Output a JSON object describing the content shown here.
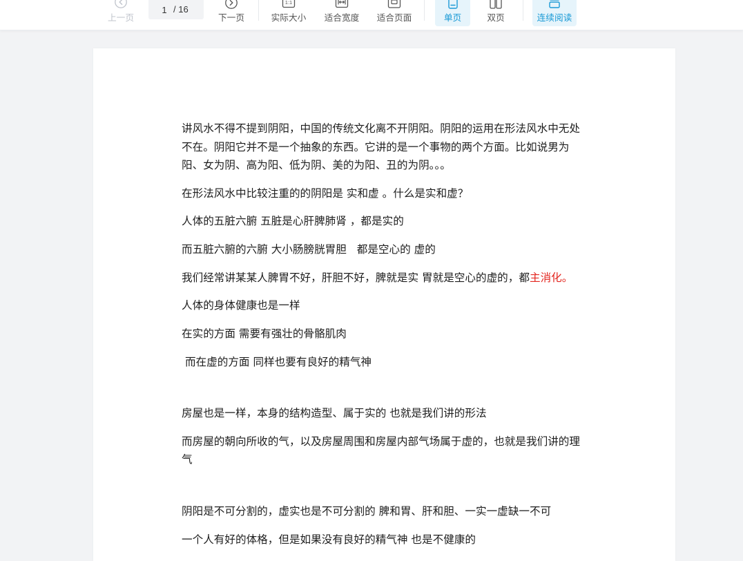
{
  "toolbar": {
    "prev_page": {
      "label": "上一页",
      "icon": "circle-arrow-left-icon",
      "disabled": true
    },
    "page_indicator": {
      "current": "1",
      "total": "/ 16"
    },
    "next_page": {
      "label": "下一页",
      "icon": "circle-arrow-right-icon"
    },
    "actual_size": {
      "label": "实际大小",
      "icon": "actual-size-icon",
      "icon_text": "1:1"
    },
    "fit_width": {
      "label": "适合宽度",
      "icon": "fit-width-icon"
    },
    "fit_page": {
      "label": "适合页面",
      "icon": "fit-page-icon"
    },
    "single_page": {
      "label": "单页",
      "icon": "single-page-icon",
      "active": true
    },
    "double_page": {
      "label": "双页",
      "icon": "double-page-icon"
    },
    "continuous_reading": {
      "label": "连续阅读",
      "icon": "continuous-scroll-icon",
      "active": true
    }
  },
  "colors": {
    "accent": "#1a9ad6",
    "accent_background": "#e6f4fb",
    "disabled": "#c0c4cc",
    "viewer_background": "#f2f3f5",
    "page_background": "#ffffff",
    "body_text": "#1e1e1e",
    "highlight_text": "#e3261f"
  },
  "document": {
    "paragraphs": [
      {
        "lines": [
          "讲风水不得不提到阴阳，中国的传统文化离不开阴阳。阴阳的运用在形法风水中无处",
          "不在。阴阳它并不是一个抽象的东西。它讲的是一个事物的两个方面。比如说男为",
          "阳、女为阴、高为阳、低为阴、美的为阳、丑的为阴。。。"
        ]
      },
      {
        "lines": [
          "在形法风水中比较注重的的阴阳是 实和虚 。什么是实和虚？"
        ]
      },
      {
        "lines": [
          "人体的五脏六腑 五脏是心肝脾肺肾 ，都是实的"
        ]
      },
      {
        "lines": [
          "而五脏六腑的六腑 大小肠膀胱胃胆   都是空心的 虚的"
        ]
      },
      {
        "runs": [
          {
            "text": "我们经常讲某某人脾胃不好，肝胆不好，脾就是实 胃就是空心的虚的，都"
          },
          {
            "text": "主消化。",
            "color": "#e3261f"
          }
        ]
      },
      {
        "lines": [
          "人体的身体健康也是一样"
        ]
      },
      {
        "lines": [
          "在实的方面 需要有强壮的骨骼肌肉"
        ]
      },
      {
        "lines": [
          " 而在虚的方面 同样也要有良好的精气神"
        ]
      },
      {
        "lines": [
          "房屋也是一样，本身的结构造型、属于实的 也就是我们讲的形法"
        ]
      },
      {
        "lines": [
          "而房屋的朝向所收的气，以及房屋周围和房屋内部气场属于虚的，也就是我们讲的理",
          "气"
        ]
      },
      {
        "lines": [
          "阴阳是不可分割的，虚实也是不可分割的 脾和胃、肝和胆、一实一虚缺一不可"
        ]
      },
      {
        "lines": [
          "一个人有好的体格，但是如果没有良好的精气神 也是不健康的"
        ]
      }
    ]
  }
}
